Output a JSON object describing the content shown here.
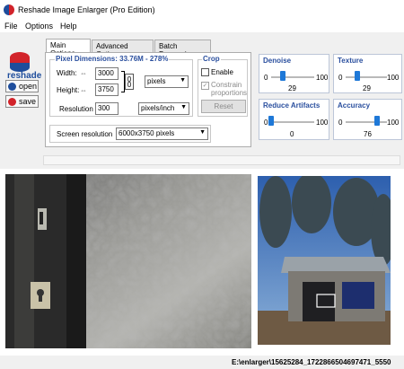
{
  "app": {
    "title": "Reshade Image Enlarger (Pro Edition)"
  },
  "menu": [
    "File",
    "Options",
    "Help"
  ],
  "sidebar": {
    "logo_text": "reshade",
    "open_label": "open",
    "save_label": "save"
  },
  "tabs": [
    "Main Options",
    "Advanced Options",
    "Batch Processing"
  ],
  "pixel_dimensions": {
    "title": "Pixel Dimensions: 33.76M - 278%",
    "width_label": "Width:",
    "width_value": "3000",
    "height_label": "Height:",
    "height_value": "3750",
    "unit": "pixels",
    "resolution_label": "Resolution",
    "resolution_value": "300",
    "resolution_unit": "pixels/inch"
  },
  "crop": {
    "title": "Crop",
    "enable_label": "Enable",
    "constrain_label": "Constrain proportions",
    "reset_label": "Reset"
  },
  "screen_resolution": {
    "label": "Screen resolution",
    "value": "6000x3750 pixels"
  },
  "sliders": {
    "denoise": {
      "label": "Denoise",
      "min": "0",
      "max": "100",
      "value": "29",
      "level": 29
    },
    "texture": {
      "label": "Texture",
      "min": "0",
      "max": "100",
      "value": "29",
      "level": 29
    },
    "reduce_artifacts": {
      "label": "Reduce Artifacts",
      "min": "0",
      "max": "100",
      "value": "0",
      "level": 0
    },
    "accuracy": {
      "label": "Accuracy",
      "min": "0",
      "max": "100",
      "value": "76",
      "level": 76
    }
  },
  "status": {
    "path": "E:\\enlarger\\15625284_1722866504697471_5550"
  },
  "colors": {
    "accent": "#2a4f9e",
    "slider_thumb": "#1e78d7",
    "logo_red": "#d2232a",
    "logo_blue": "#1e4d9c"
  }
}
